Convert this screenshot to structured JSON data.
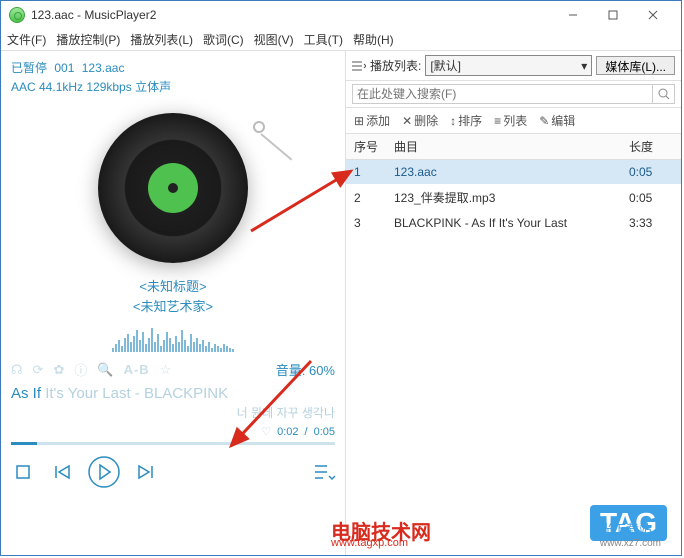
{
  "window": {
    "title": "123.aac - MusicPlayer2"
  },
  "menu": {
    "file": "文件(F)",
    "playctrl": "播放控制(P)",
    "playlist": "播放列表(L)",
    "lyrics": "歌词(C)",
    "view": "视图(V)",
    "tools": "工具(T)",
    "help": "帮助(H)"
  },
  "status": {
    "paused": "已暂停",
    "track_num": "001",
    "track_name": "123.aac",
    "format_line": "AAC 44.1kHz 129kbps 立体声"
  },
  "meta": {
    "title": "<未知标题>",
    "artist": "<未知艺术家>"
  },
  "toolbar": {
    "ab": "A-B",
    "hint_cn": "音量",
    "volume_label": "音量: 60%"
  },
  "now_playing": {
    "prefix": "As If ",
    "rest": "It's Your Last - BLACKPINK",
    "lyric": "너 뭔데 자꾸 생각나"
  },
  "time": {
    "current": "0:02",
    "total": "0:05"
  },
  "playlist_header": {
    "label": "播放列表:",
    "selected": "[默认]",
    "medialib": "媒体库(L)..."
  },
  "search": {
    "placeholder": "在此处键入搜索(F)"
  },
  "playlist_toolbar": {
    "add": "添加",
    "delete": "删除",
    "sort": "排序",
    "list": "列表",
    "edit": "编辑"
  },
  "table": {
    "headers": {
      "num": "序号",
      "track": "曲目",
      "length": "长度"
    },
    "rows": [
      {
        "num": "1",
        "track": "123.aac",
        "length": "0:05",
        "selected": true
      },
      {
        "num": "2",
        "track": "123_伴奏提取.mp3",
        "length": "0:05",
        "selected": false
      },
      {
        "num": "3",
        "track": "BLACKPINK - As If It's Your Last",
        "length": "3:33",
        "selected": false
      }
    ]
  },
  "watermark": {
    "cn": "电脑技术网",
    "cn_sub": "www.tagxp.com",
    "tag": "TAG",
    "right": "光下载站",
    "right_sub": "www.xz7.com"
  }
}
